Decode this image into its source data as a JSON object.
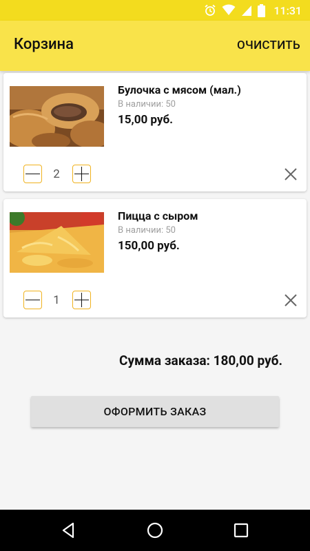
{
  "status_bar": {
    "time": "11:31"
  },
  "app_bar": {
    "title": "Корзина",
    "clear_label": "ОЧИСТИТЬ"
  },
  "cart": {
    "items": [
      {
        "name": "Булочка с мясом (мал.)",
        "stock": "В наличии: 50",
        "price": "15,00 руб.",
        "quantity": "2"
      },
      {
        "name": "Пицца с сыром",
        "stock": "В наличии: 50",
        "price": "150,00 руб.",
        "quantity": "1"
      }
    ]
  },
  "summary": {
    "total": "Сумма заказа: 180,00 руб."
  },
  "actions": {
    "order_label": "ОФОРМИТЬ ЗАКАЗ"
  },
  "icons": {
    "status": [
      "alarm-icon",
      "wifi-icon",
      "signal-icon",
      "battery-icon"
    ],
    "qty": [
      "minus-icon",
      "plus-icon"
    ],
    "remove": "close-icon",
    "nav": [
      "back-icon",
      "home-icon",
      "recents-icon"
    ]
  },
  "colors": {
    "status_bar": "#f3dc1e",
    "app_bar": "#f9e34a",
    "qty_border": "#f0b21e",
    "order_button": "#e0e0e0",
    "nav_bar": "#000000"
  }
}
